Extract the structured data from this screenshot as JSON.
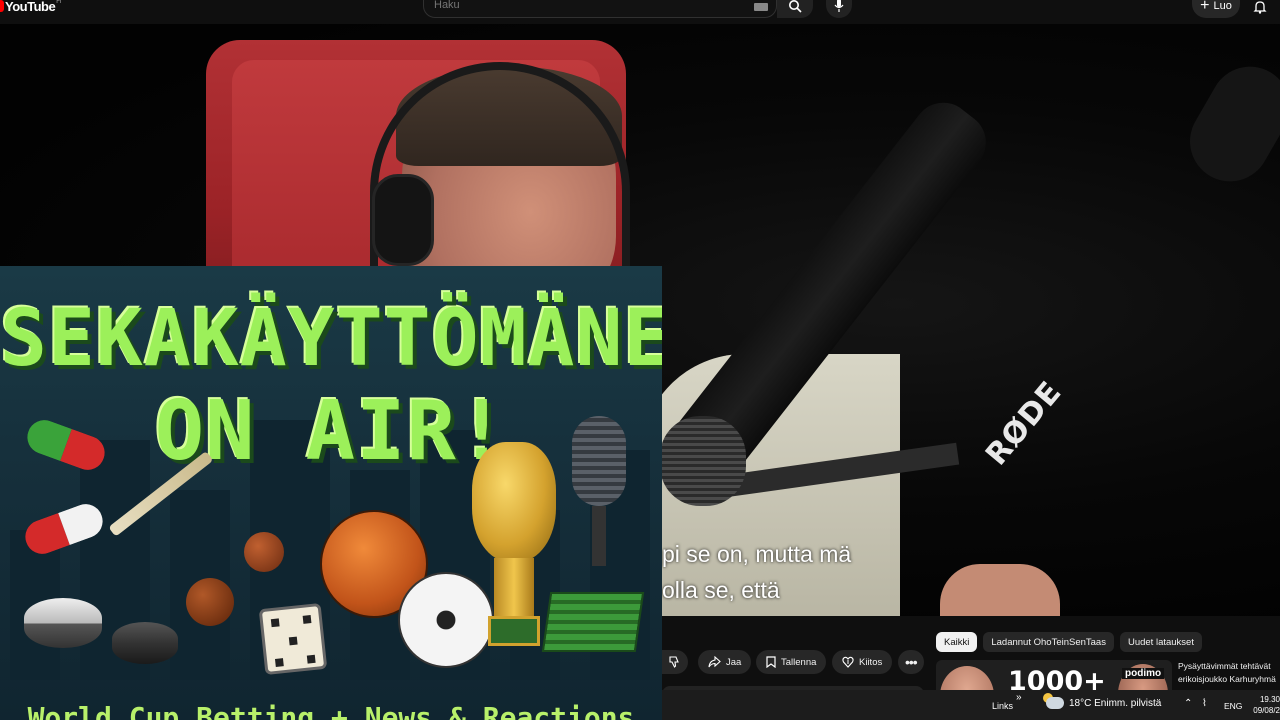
{
  "header": {
    "logo_text": "YouTube",
    "logo_suffix": "FI",
    "search_placeholder": "Haku",
    "create_label": "Luo"
  },
  "video": {
    "subtitle_line1": "pi se on, mutta mä",
    "subtitle_line2": "olla se, että",
    "mic_brand": "RØDE"
  },
  "overlay": {
    "title_line1": "SEKAKÄYTTÖMÄNE",
    "title_line2": "ON AIR!",
    "caption": "World Cup Betting + News & Reactions"
  },
  "actions": {
    "share_label": "Jaa",
    "save_label": "Tallenna",
    "thanks_label": "Kiitos"
  },
  "chips": [
    {
      "label": "Kaikki",
      "active": true
    },
    {
      "label": "Ladannut OhoTeinSenTaas",
      "active": false
    },
    {
      "label": "Uudet lataukset",
      "active": false
    }
  ],
  "recommendation": {
    "thumb_number": "1000+",
    "thumb_brand": "podimo",
    "title": "Pysäyttävimmät tehtävät",
    "channel": "erikoisjoukko Karhuryhmä"
  },
  "taskbar": {
    "links_label": "Links",
    "chevron": "»",
    "weather": "18°C  Enimm. pilvistä",
    "language": "ENG",
    "time": "19.30",
    "date": "09/08/2"
  },
  "colors": {
    "accent_red": "#ff0000",
    "overlay_title_green": "#9cf05a",
    "background": "#0f0f0f"
  }
}
